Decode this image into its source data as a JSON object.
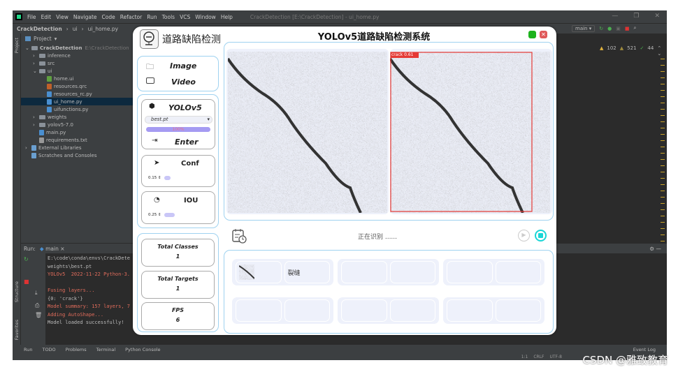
{
  "ide": {
    "menu": [
      "File",
      "Edit",
      "View",
      "Navigate",
      "Code",
      "Refactor",
      "Run",
      "Tools",
      "VCS",
      "Window",
      "Help"
    ],
    "window_title": "CrackDetection [E:\\CrackDetection] - ui_home.py",
    "breadcrumb": [
      "CrackDetection",
      "ui",
      "ui_home.py"
    ],
    "run_config": "main",
    "project_header": "Project",
    "tree": [
      {
        "label": "CrackDetection",
        "extra": "E:\\CrackDetection",
        "type": "folder",
        "indent": 0
      },
      {
        "label": "inference",
        "type": "folder",
        "indent": 1
      },
      {
        "label": "src",
        "type": "folder",
        "indent": 1
      },
      {
        "label": "ui",
        "type": "folder",
        "indent": 1
      },
      {
        "label": "home.ui",
        "type": "ui",
        "indent": 2
      },
      {
        "label": "resources.qrc",
        "type": "qrc",
        "indent": 2
      },
      {
        "label": "resources_rc.py",
        "type": "py",
        "indent": 2
      },
      {
        "label": "ui_home.py",
        "type": "py",
        "indent": 2,
        "selected": true
      },
      {
        "label": "uifunctions.py",
        "type": "py",
        "indent": 2
      },
      {
        "label": "weights",
        "type": "folder",
        "indent": 1
      },
      {
        "label": "yolov5-7.0",
        "type": "folder",
        "indent": 1
      },
      {
        "label": "main.py",
        "type": "py",
        "indent": 1
      },
      {
        "label": "requirements.txt",
        "type": "txt",
        "indent": 1
      },
      {
        "label": "External Libraries",
        "type": "lib",
        "indent": 0
      },
      {
        "label": "Scratches and Consoles",
        "type": "scratch",
        "indent": 0
      }
    ],
    "inspections": {
      "warnings": "102",
      "weak_warnings": "521",
      "typos": "44"
    },
    "run_tab_label": "Run:",
    "run_tab": "main",
    "console": [
      {
        "text": "E:\\code\\conda\\envs\\CrackDete",
        "color": "white"
      },
      {
        "text": "weights\\best.pt",
        "color": "white"
      },
      {
        "text": "YOLOv5  2022-11-22 Python-3.",
        "color": "red"
      },
      {
        "text": "",
        "color": "white"
      },
      {
        "text": "Fusing layers...",
        "color": "red"
      },
      {
        "text": "{0: 'crack'}",
        "color": "white"
      },
      {
        "text": "Model summary: 157 layers, 7",
        "color": "red"
      },
      {
        "text": "Adding AutoShape...",
        "color": "red"
      },
      {
        "text": "Model loaded successfully!",
        "color": "white"
      }
    ],
    "side_labels": {
      "project": "Project",
      "structure": "Structure",
      "favorites": "Favorites"
    },
    "bottom_tabs": [
      "Run",
      "TODO",
      "Problems",
      "Terminal",
      "Python Console"
    ],
    "event_log": "Event Log",
    "status": [
      "1:1",
      "CRLF",
      "UTF-8"
    ]
  },
  "app": {
    "subtitle": "道路缺陷检测",
    "title": "YOLOv5道路缺陷检测系统",
    "colors": {
      "accent_border": "#9fd2f0",
      "progress": "#a59bf2",
      "minimize": "#1db31d",
      "close": "#e05a5a",
      "stop": "#1ad6d6"
    },
    "source": {
      "image_label": "Image",
      "video_label": "Video"
    },
    "model": {
      "name": "YOLOv5",
      "selected_weights": "best.pt",
      "progress_text": "100%",
      "progress": 100,
      "enter_label": "Enter"
    },
    "conf": {
      "label": "Conf",
      "value": "0.15",
      "slider": 0.15
    },
    "iou": {
      "label": "IOU",
      "value": "0.25",
      "slider": 0.25
    },
    "stats": [
      {
        "label": "Total Classes",
        "value": "1"
      },
      {
        "label": "Total Targets",
        "value": "1"
      },
      {
        "label": "FPS",
        "value": "6"
      }
    ],
    "detection_label": "crack  0.61",
    "status_text": "正在识别 ......",
    "results": [
      {
        "label": "裂缝"
      }
    ]
  },
  "watermark": "CSDN @雅致教育"
}
